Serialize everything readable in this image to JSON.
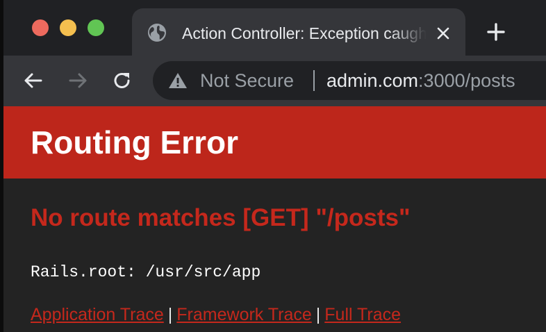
{
  "window": {
    "traffic_lights": [
      "close",
      "minimize",
      "zoom"
    ]
  },
  "tab": {
    "title": "Action Controller: Exception caught",
    "icon": "globe-icon",
    "close_icon": "close-icon"
  },
  "new_tab": {
    "icon": "plus-icon"
  },
  "toolbar": {
    "back_icon": "arrow-left-icon",
    "forward_icon": "arrow-right-icon",
    "reload_icon": "reload-icon"
  },
  "omnibox": {
    "security_icon": "warning-icon",
    "security_label": "Not Secure",
    "url_host": "admin.com",
    "url_rest": ":3000/posts"
  },
  "page": {
    "header_title": "Routing Error",
    "error_message": "No route matches [GET] \"/posts\"",
    "rails_root": "Rails.root: /usr/src/app",
    "trace_links": {
      "application": "Application Trace",
      "framework": "Framework Trace",
      "full": "Full Trace",
      "separator": "|"
    }
  },
  "colors": {
    "header_bg": "#bd261b",
    "error_text": "#c5281c",
    "page_bg": "#232323",
    "tabstrip_bg": "#202124",
    "toolbar_bg": "#35363a"
  }
}
